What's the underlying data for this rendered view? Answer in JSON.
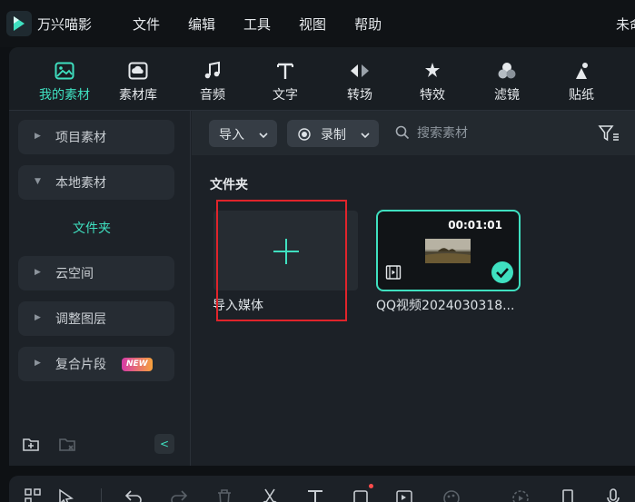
{
  "app": {
    "name": "万兴喵影",
    "title_right": "未命"
  },
  "menu": {
    "items": [
      "文件",
      "编辑",
      "工具",
      "视图",
      "帮助"
    ]
  },
  "tabs": [
    {
      "label": "我的素材",
      "icon": "my-media-icon",
      "active": true
    },
    {
      "label": "素材库",
      "icon": "stock-media-icon",
      "active": false
    },
    {
      "label": "音频",
      "icon": "audio-icon",
      "active": false
    },
    {
      "label": "文字",
      "icon": "text-icon",
      "active": false
    },
    {
      "label": "转场",
      "icon": "transition-icon",
      "active": false
    },
    {
      "label": "特效",
      "icon": "effects-icon",
      "active": false
    },
    {
      "label": "滤镜",
      "icon": "filter-icon",
      "active": false
    },
    {
      "label": "贴纸",
      "icon": "sticker-icon",
      "active": false
    }
  ],
  "sidebar": {
    "items": [
      {
        "label": "项目素材",
        "expanded": false
      },
      {
        "label": "本地素材",
        "expanded": true
      },
      {
        "label": "云空间",
        "expanded": false
      },
      {
        "label": "调整图层",
        "expanded": false
      },
      {
        "label": "复合片段",
        "expanded": false,
        "badge": "NEW"
      }
    ],
    "sub_item": "文件夹"
  },
  "toolbar": {
    "import_label": "导入",
    "record_label": "录制",
    "search_placeholder": "搜索素材"
  },
  "content": {
    "folder_title": "文件夹",
    "import_tile_label": "导入媒体",
    "video": {
      "duration": "00:01:01",
      "name": "QQ视频2024030318..."
    }
  },
  "colors": {
    "accent": "#3fe0c0",
    "highlight": "#e0242b",
    "background": "#1c2127"
  },
  "bottom_toolbar": {
    "icons": [
      "layout-icon",
      "pointer-icon",
      "undo-icon",
      "redo-icon",
      "delete-icon",
      "cut-icon",
      "text-tool-icon",
      "crop-icon",
      "speed-icon",
      "color-icon",
      "render-icon",
      "marker-icon",
      "mic-icon"
    ]
  }
}
